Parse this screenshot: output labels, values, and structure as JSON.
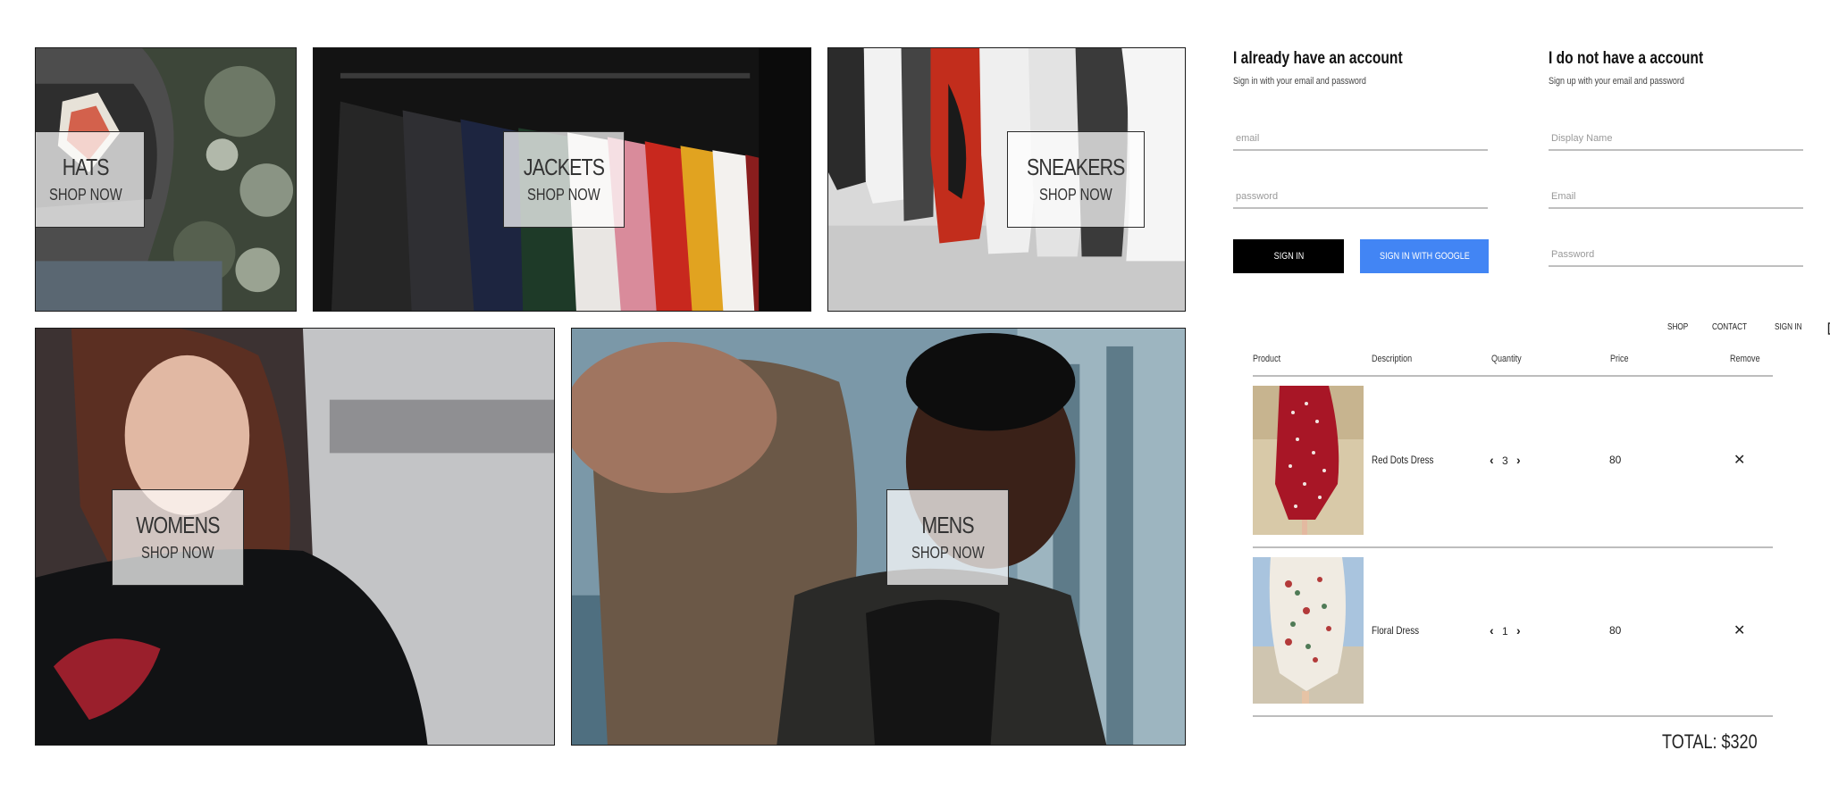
{
  "categories": [
    {
      "title": "HATS",
      "cta": "SHOP NOW"
    },
    {
      "title": "JACKETS",
      "cta": "SHOP NOW"
    },
    {
      "title": "SNEAKERS",
      "cta": "SHOP NOW"
    },
    {
      "title": "WOMENS",
      "cta": "SHOP NOW"
    },
    {
      "title": "MENS",
      "cta": "SHOP NOW"
    }
  ],
  "signin": {
    "title": "I already have an account",
    "subtitle": "Sign in with your email and password",
    "email_placeholder": "email",
    "password_placeholder": "password",
    "signin_label": "SIGN IN",
    "google_label": "SIGN IN WITH GOOGLE",
    "google_color": "#4285f4"
  },
  "signup": {
    "title": "I do not have a account",
    "subtitle": "Sign up with your email and password",
    "display_name_placeholder": "Display Name",
    "email_placeholder": "Email",
    "password_placeholder": "Password"
  },
  "nav": {
    "shop": "SHOP",
    "contact": "CONTACT",
    "signin": "SIGN IN",
    "cart_icon": "shopping-bag-icon"
  },
  "cart": {
    "headers": {
      "product": "Product",
      "description": "Description",
      "quantity": "Quantity",
      "price": "Price",
      "remove": "Remove"
    },
    "items": [
      {
        "name": "Red Dots Dress",
        "quantity": "3",
        "price": "80"
      },
      {
        "name": "Floral Dress",
        "quantity": "1",
        "price": "80"
      }
    ],
    "total": "TOTAL: $320"
  }
}
